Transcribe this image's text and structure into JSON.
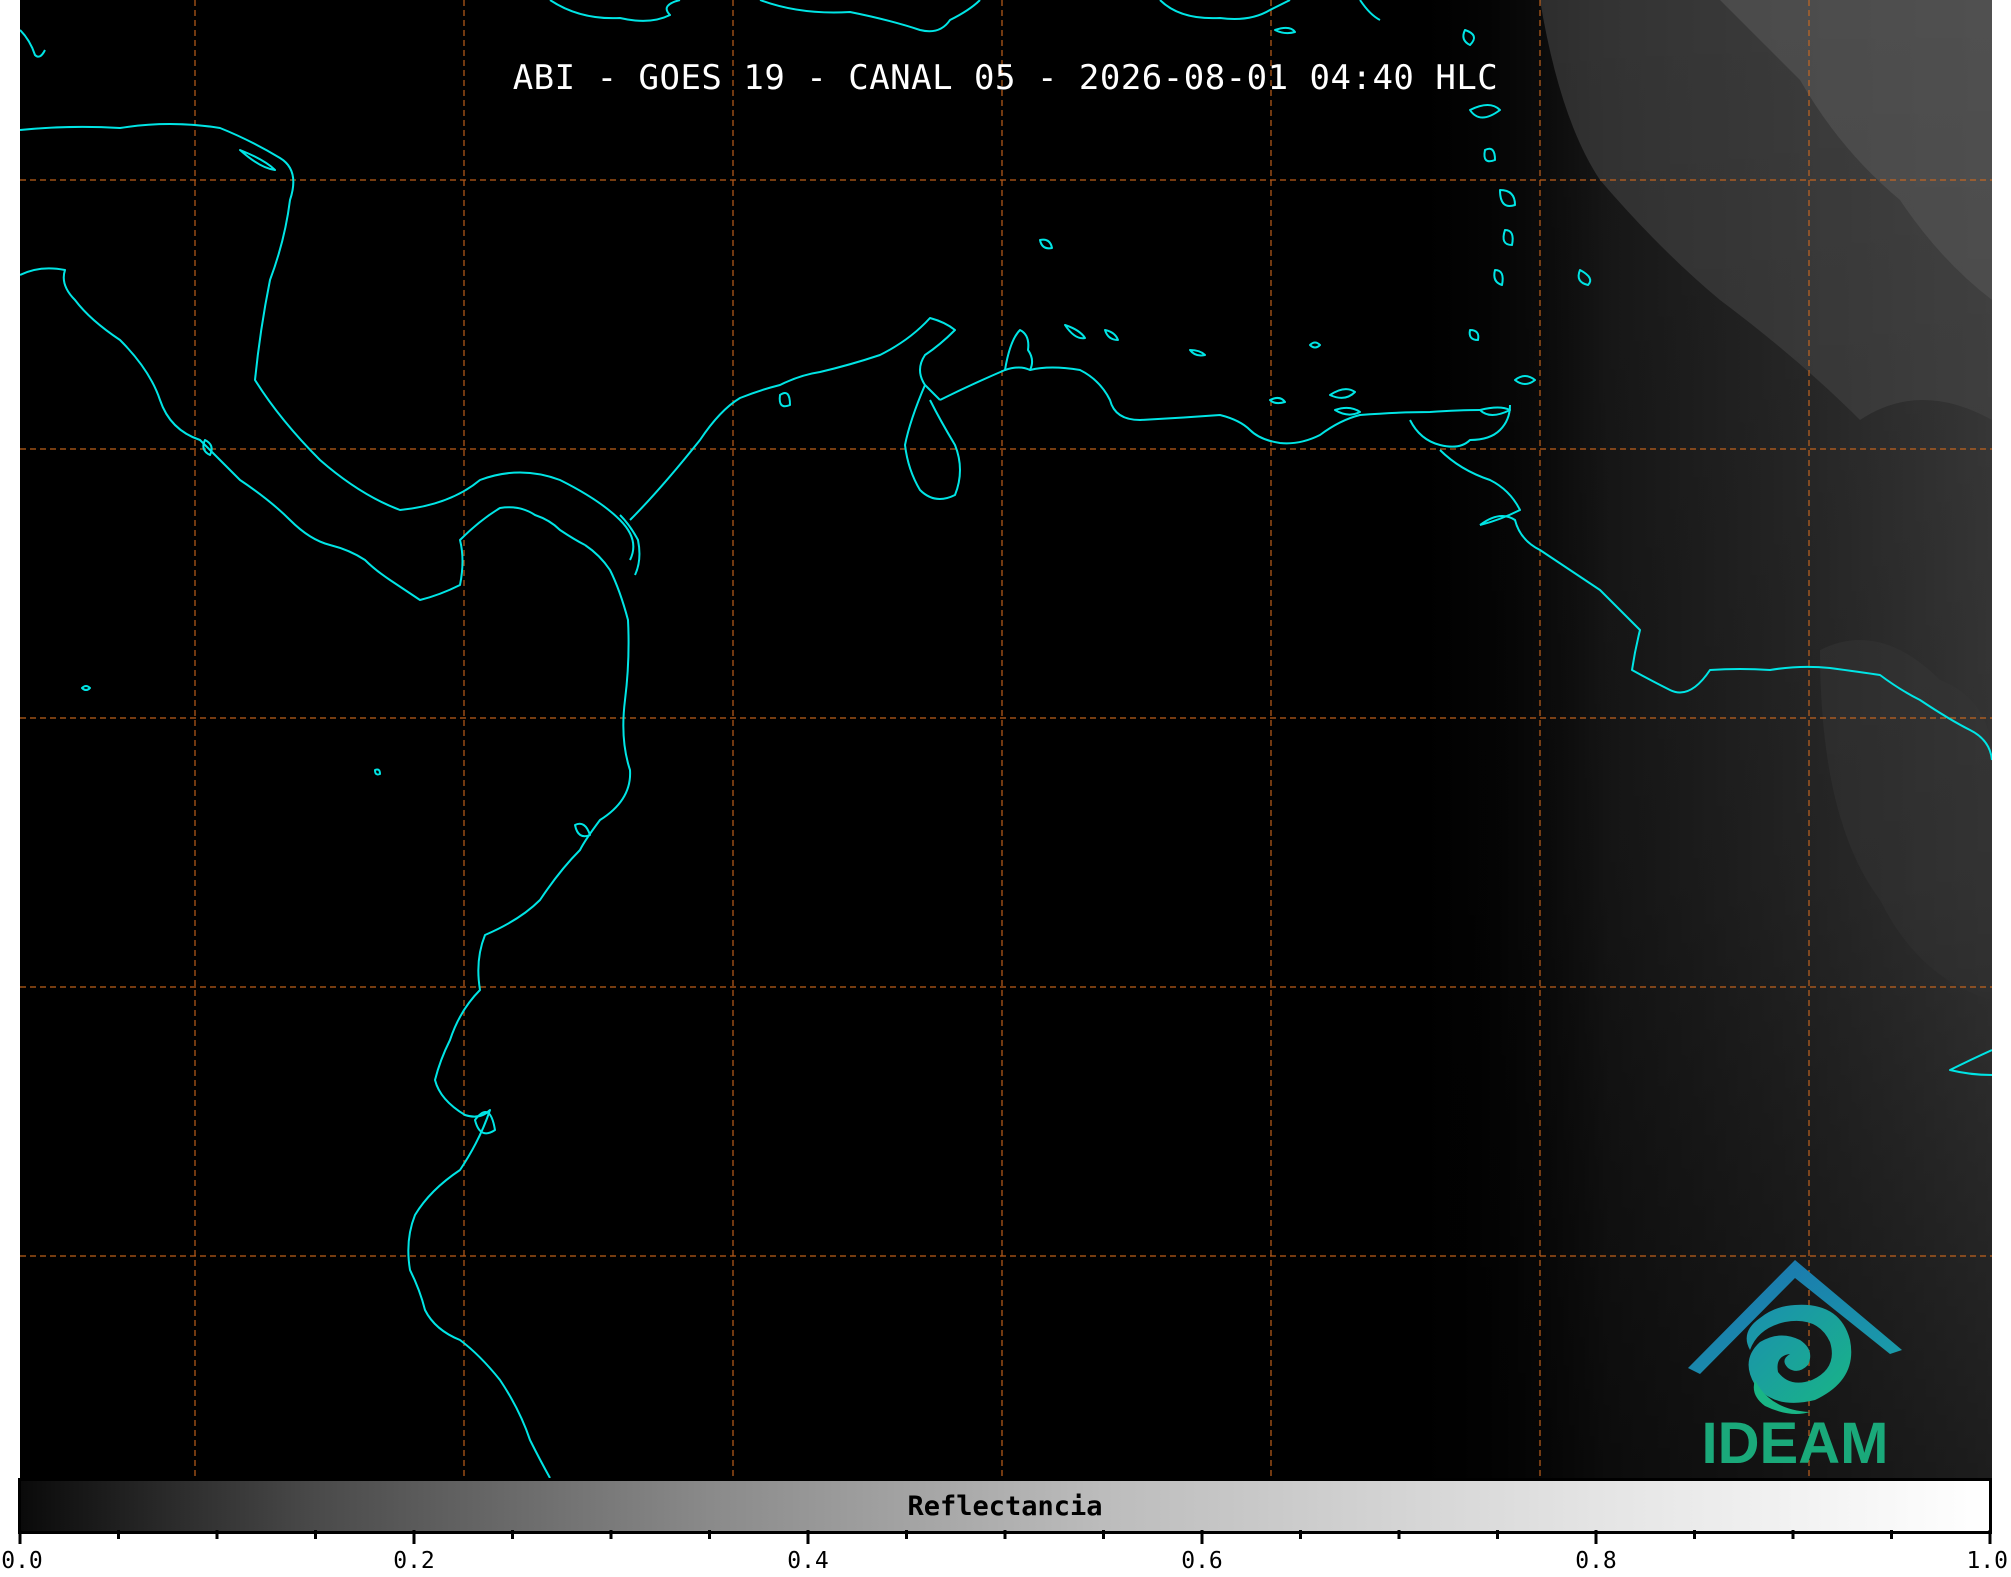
{
  "title": "ABI - GOES 19 - CANAL 05 - 2026-08-01 04:40 HLC",
  "colorbar": {
    "label": "Reflectancia",
    "tick_labels": [
      "0.0",
      "0.2",
      "0.4",
      "0.6",
      "0.8",
      "1.0"
    ],
    "range": [
      0.0,
      1.0
    ]
  },
  "logo": {
    "text": "IDEAM"
  },
  "colors": {
    "background": "#000000",
    "coastline": "#00e5e5",
    "gridlines": "#d2691e",
    "logo_text": "#1aa97a"
  }
}
